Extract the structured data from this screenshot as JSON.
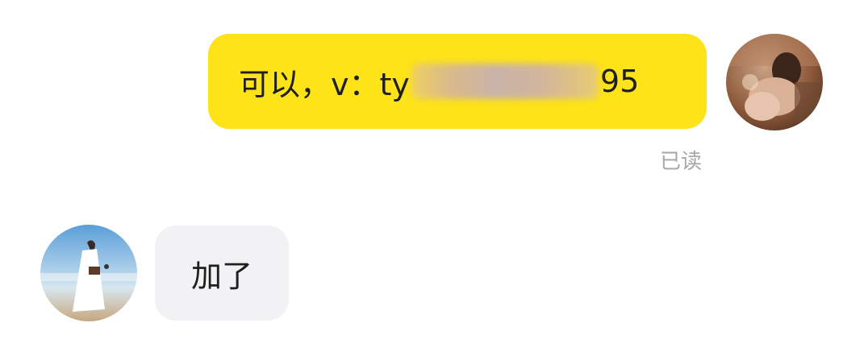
{
  "messages": [
    {
      "direction": "outgoing",
      "text_prefix": "可以，v：ty",
      "text_suffix": "95",
      "redacted": true,
      "status": "已读",
      "bubble_color": "#fde318",
      "avatar_icon": "avatar-self"
    },
    {
      "direction": "incoming",
      "text": "加了",
      "bubble_color": "#f2f2f4",
      "avatar_icon": "avatar-peer"
    }
  ]
}
